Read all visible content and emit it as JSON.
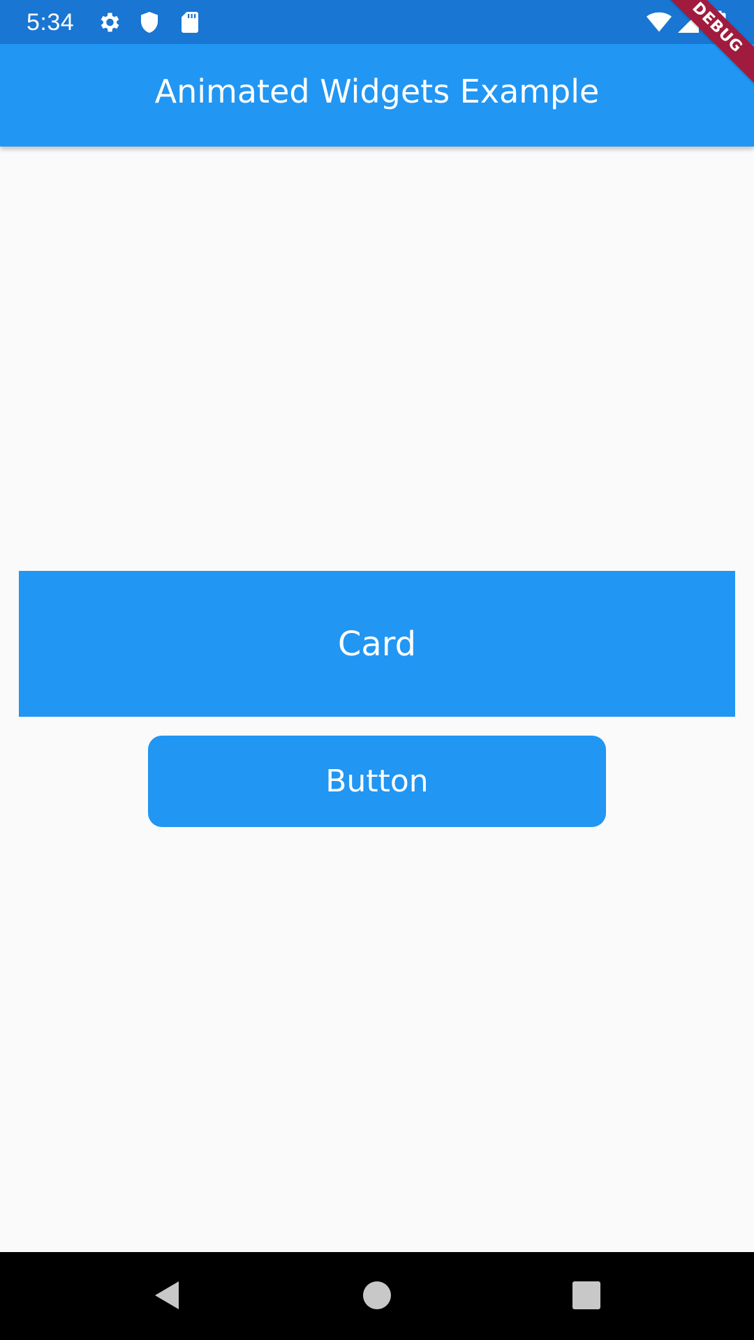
{
  "status_bar": {
    "time": "5:34",
    "icons": [
      "gear-icon",
      "shield-icon",
      "sd-card-icon",
      "wifi-icon",
      "signal-icon",
      "battery-icon"
    ]
  },
  "app_bar": {
    "title": "Animated Widgets Example"
  },
  "debug_banner": {
    "label": "DEBUG"
  },
  "main": {
    "card_label": "Card",
    "button_label": "Button"
  },
  "nav_bar": {
    "buttons": [
      "back-icon",
      "home-icon",
      "recents-icon"
    ]
  },
  "colors": {
    "status_bar": "#1976d2",
    "app_bar": "#2196f3",
    "primary": "#2196f3",
    "background": "#fafafa",
    "debug_banner": "#a01b3d",
    "nav_bar": "#000000"
  }
}
